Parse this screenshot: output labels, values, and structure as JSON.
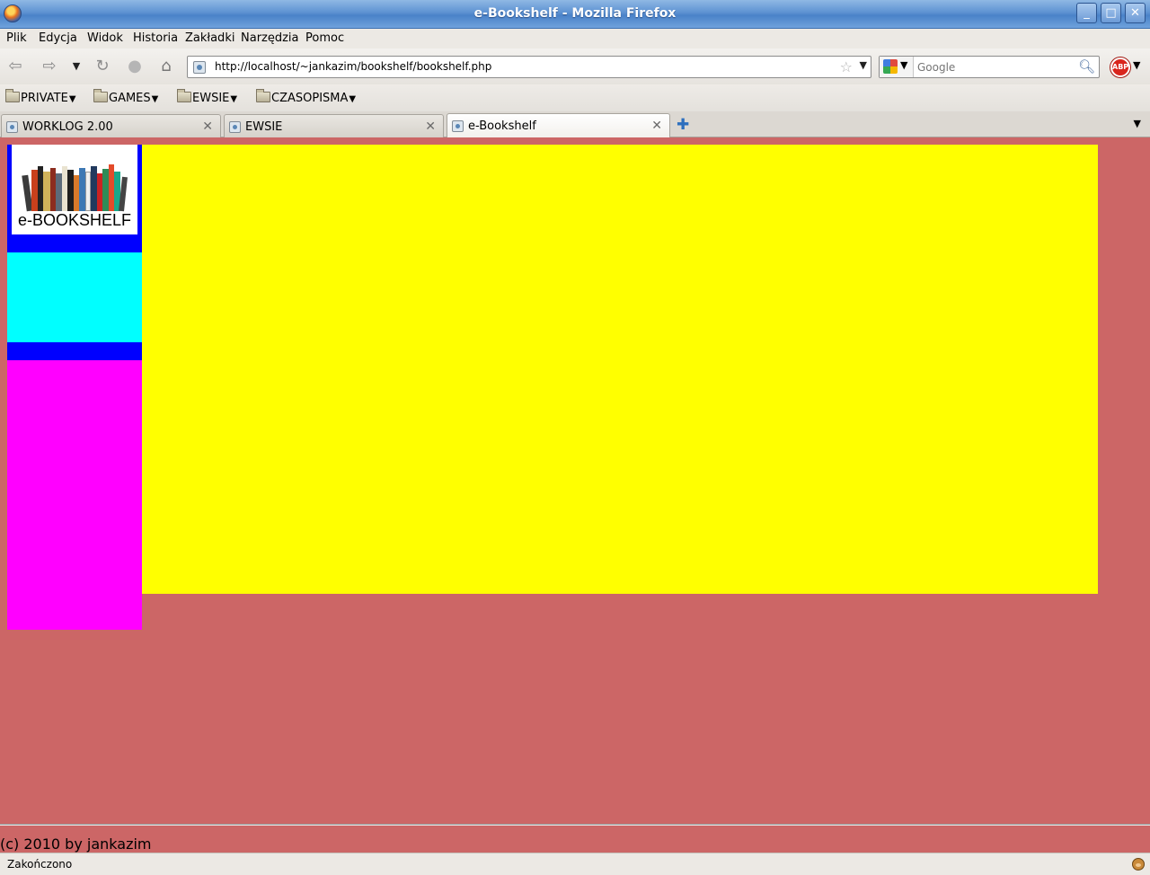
{
  "window": {
    "title": "e-Bookshelf - Mozilla Firefox",
    "controls": {
      "minimize": "_",
      "maximize": "□",
      "close": "✕"
    }
  },
  "menubar": {
    "items": [
      {
        "label": "Plik"
      },
      {
        "label": "Edycja"
      },
      {
        "label": "Widok"
      },
      {
        "label": "Historia"
      },
      {
        "label": "Zakładki"
      },
      {
        "label": "Narzędzia"
      },
      {
        "label": "Pomoc"
      }
    ]
  },
  "navbar": {
    "back_icon": "back-arrow-icon",
    "forward_icon": "forward-arrow-icon",
    "history_dropdown_icon": "chevron-down-icon",
    "reload_icon": "reload-icon",
    "stop_icon": "stop-icon",
    "home_icon": "home-icon",
    "url": "http://localhost/~jankazim/bookshelf/bookshelf.php",
    "search_placeholder": "Google"
  },
  "bookmarks": [
    {
      "label": "PRIVATE"
    },
    {
      "label": "GAMES"
    },
    {
      "label": "EWSIE"
    },
    {
      "label": "CZASOPISMA"
    }
  ],
  "tabs": [
    {
      "label": "WORKLOG 2.00",
      "active": false
    },
    {
      "label": "EWSIE",
      "active": false
    },
    {
      "label": "e-Bookshelf",
      "active": true
    }
  ],
  "page": {
    "background": "#cc6666",
    "logo_text": "e-BOOKSHELF",
    "colors": {
      "logo_frame": "#0000ff",
      "cyan_panel": "#00ffff",
      "magenta_panel": "#ff00ff",
      "main_area": "#ffff00"
    },
    "footer": "(c) 2010 by jankazim"
  },
  "statusbar": {
    "text": "Zakończono"
  }
}
